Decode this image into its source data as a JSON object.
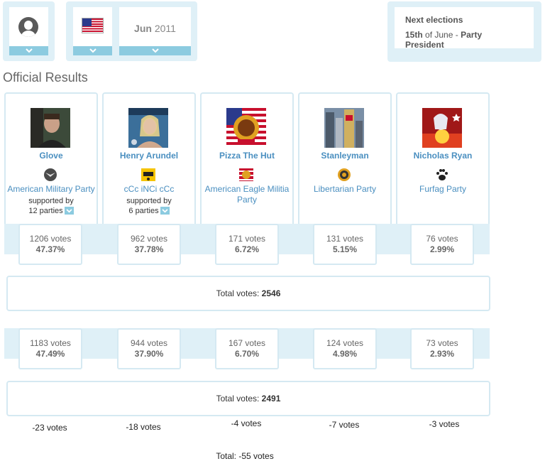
{
  "filters": {
    "date": {
      "month": "Jun",
      "year": "2011"
    }
  },
  "next_elections": {
    "title": "Next elections",
    "day": "15th",
    "of": "of June",
    "sep": "-",
    "type": "Party President"
  },
  "section_title": "Official Results",
  "candidates": [
    {
      "name": "Glove",
      "party": "American Military Party",
      "supported_label": "supported by",
      "supported_count": "12 parties",
      "official_votes": "1206 votes",
      "official_pct": "47.37%",
      "second_votes": "1183 votes",
      "second_pct": "47.49%",
      "diff": "-23 votes"
    },
    {
      "name": "Henry Arundel",
      "party": "cCc iNCi cCc",
      "supported_label": "supported by",
      "supported_count": "6 parties",
      "official_votes": "962 votes",
      "official_pct": "37.78%",
      "second_votes": "944 votes",
      "second_pct": "37.90%",
      "diff": "-18 votes"
    },
    {
      "name": "Pizza The Hut",
      "party": "American Eagle Militia Party",
      "supported_label": "",
      "supported_count": "",
      "official_votes": "171 votes",
      "official_pct": "6.72%",
      "second_votes": "167 votes",
      "second_pct": "6.70%",
      "diff": "-4 votes"
    },
    {
      "name": "Stanleyman",
      "party": "Libertarian Party",
      "supported_label": "",
      "supported_count": "",
      "official_votes": "131 votes",
      "official_pct": "5.15%",
      "second_votes": "124 votes",
      "second_pct": "4.98%",
      "diff": "-7 votes"
    },
    {
      "name": "Nicholas Ryan",
      "party": "Furfag Party",
      "supported_label": "",
      "supported_count": "",
      "official_votes": "76 votes",
      "official_pct": "2.99%",
      "second_votes": "73 votes",
      "second_pct": "2.93%",
      "diff": "-3 votes"
    }
  ],
  "totals": {
    "label": "Total votes:",
    "official": "2546",
    "second": "2491",
    "diff_text": "Total: -55 votes"
  },
  "icons": {
    "profile": "user-avatar-icon",
    "country": "us-flag-icon",
    "dropdown": "chevron-down-icon"
  },
  "colors": {
    "panel": "#dff0f7",
    "dropdown": "#8ccbe0",
    "link": "#4a8fc0",
    "border": "#d5e9f2"
  }
}
